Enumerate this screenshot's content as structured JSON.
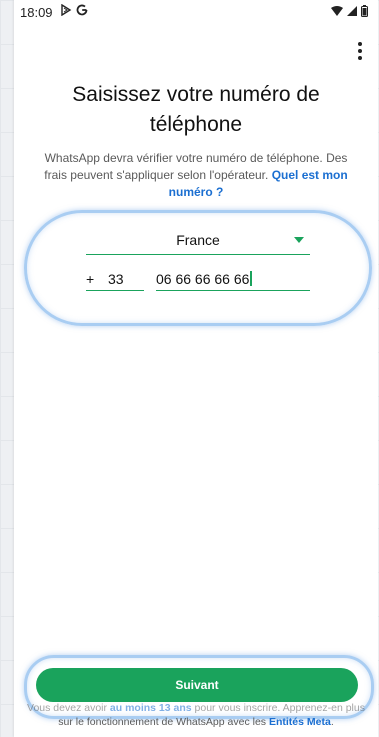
{
  "status_bar": {
    "time": "18:09",
    "left_icons": [
      "play-protect-icon",
      "google-icon"
    ],
    "right_icons": [
      "wifi-icon",
      "signal-icon",
      "battery-icon"
    ]
  },
  "header": {
    "title": "Saisissez votre numéro de téléphone",
    "subtitle_text": "WhatsApp devra vérifier votre numéro de téléphone. Des frais peuvent s'appliquer selon l'opérateur.",
    "subtitle_link": "Quel est mon numéro ?"
  },
  "form": {
    "country": "France",
    "plus_sign": "+",
    "country_code": "33",
    "phone_number": "06 66 66 66 66"
  },
  "actions": {
    "next_label": "Suivant"
  },
  "footer": {
    "line1_prefix": "Vous devez avoir ",
    "line1_bold": "au moins 13 ans",
    "line1_suffix": " pour vous inscrire. Apprenez-en plus",
    "line2_prefix": "sur le fonctionnement de WhatsApp avec les ",
    "line2_link": "Entités Meta",
    "line2_suffix": "."
  },
  "colors": {
    "accent": "#1aa35c",
    "link": "#1b6fd1",
    "highlight": "#a9cdf2"
  }
}
